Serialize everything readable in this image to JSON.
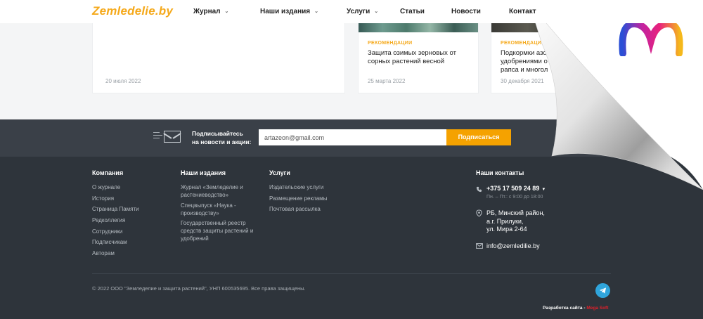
{
  "header": {
    "logo": "Zemledelie.by",
    "nav": [
      {
        "label": "Журнал",
        "dropdown": true
      },
      {
        "label": "Наши издания",
        "dropdown": true
      },
      {
        "label": "Услуги",
        "dropdown": true
      },
      {
        "label": "Статьи",
        "dropdown": false
      },
      {
        "label": "Новости",
        "dropdown": false
      },
      {
        "label": "Контакт",
        "dropdown": false
      }
    ]
  },
  "cards": [
    {
      "date": "20 июля 2022"
    },
    {
      "tag": "РЕКОМЕНДАЦИИ",
      "title": "Защита озимых зерновых от сорных растений весной",
      "date": "25 марта 2022"
    },
    {
      "tag": "РЕКОМЕНДАЦИИ",
      "title": "Подкормки азо удобрениями о рапса и многол",
      "date": "30 декабря 2021"
    }
  ],
  "subscribe": {
    "text_line1": "Подписывайтесь",
    "text_line2": "на новости и акции:",
    "email_value": "artazeon@gmail.com",
    "button": "Подписаться"
  },
  "footer": {
    "company": {
      "heading": "Компания",
      "links": [
        "О журнале",
        "История",
        "Страница Памяти",
        "Редколлегия",
        "Сотрудники",
        "Подписчикам",
        "Авторам"
      ]
    },
    "editions": {
      "heading": "Наши издания",
      "links": [
        "Журнал «Земледелие и растениеводство»",
        "Спецвыпуск «Наука - производству»",
        "Государственный реестр средств защиты растений и удобрений"
      ]
    },
    "services": {
      "heading": "Услуги",
      "links": [
        "Издательские услуги",
        "Размещение рекламы",
        "Почтовая рассылка"
      ]
    },
    "contacts": {
      "heading": "Наши контакты",
      "phone": "+375 17 509 24 89",
      "hours": "Пн. – Пт.: с 9:00 до 18:00",
      "address_line1": "РБ, Минский район,",
      "address_line2": "а.г. Прилуки,",
      "address_line3": "ул. Мира 2-64",
      "email": "info@zemledilie.by"
    },
    "copyright": "© 2022 ООО \"Земледелие и защита растений\", УНП 600535695. Все права защищены.",
    "developer_label": "Разработка сайта - ",
    "developer_brand": "Mega Soft"
  },
  "colors": {
    "accent": "#f5a91b",
    "footer_bg": "#2e343b",
    "telegram": "#2fa5dc"
  }
}
